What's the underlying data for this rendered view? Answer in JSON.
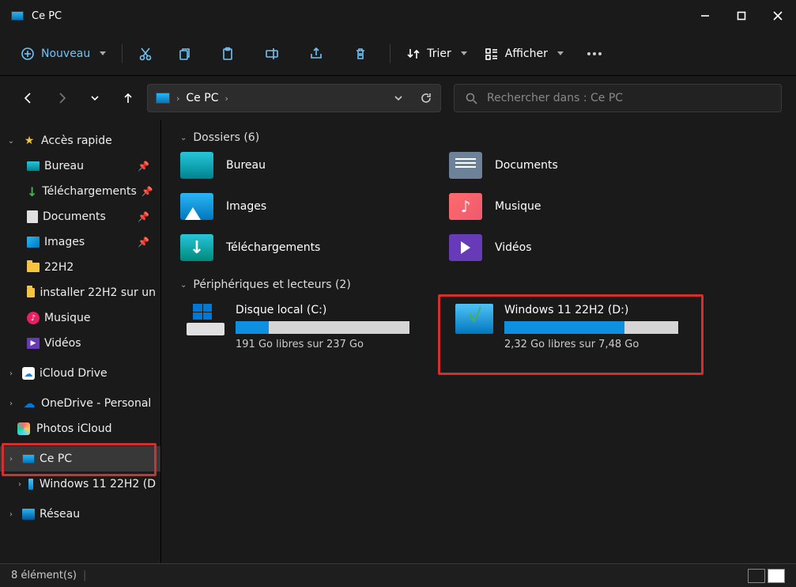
{
  "window": {
    "title": "Ce PC"
  },
  "toolbar": {
    "nouveau": "Nouveau",
    "trier": "Trier",
    "afficher": "Afficher"
  },
  "breadcrumb": {
    "root": "Ce PC"
  },
  "search": {
    "placeholder": "Rechercher dans : Ce PC"
  },
  "sidebar": {
    "quick_access": "Accès rapide",
    "bureau": "Bureau",
    "telechargements": "Téléchargements",
    "documents": "Documents",
    "images": "Images",
    "h22h2": "22H2",
    "installer": "installer 22H2 sur un",
    "musique": "Musique",
    "videos": "Vidéos",
    "icloud": "iCloud Drive",
    "onedrive": "OneDrive - Personal",
    "photos": "Photos iCloud",
    "cepc": "Ce PC",
    "win11": "Windows 11 22H2 (D",
    "reseau": "Réseau"
  },
  "sections": {
    "folders_title": "Dossiers (6)",
    "folders": {
      "bureau": "Bureau",
      "documents": "Documents",
      "images": "Images",
      "musique": "Musique",
      "telechargements": "Téléchargements",
      "videos": "Vidéos"
    },
    "drives_title": "Périphériques et lecteurs (2)",
    "drive_c": {
      "name": "Disque local (C:)",
      "free": "191 Go libres sur 237 Go",
      "percent_used": 19
    },
    "drive_d": {
      "name": "Windows 11 22H2 (D:)",
      "free": "2,32 Go libres sur 7,48 Go",
      "percent_used": 69
    }
  },
  "statusbar": {
    "items": "8 élément(s)"
  }
}
